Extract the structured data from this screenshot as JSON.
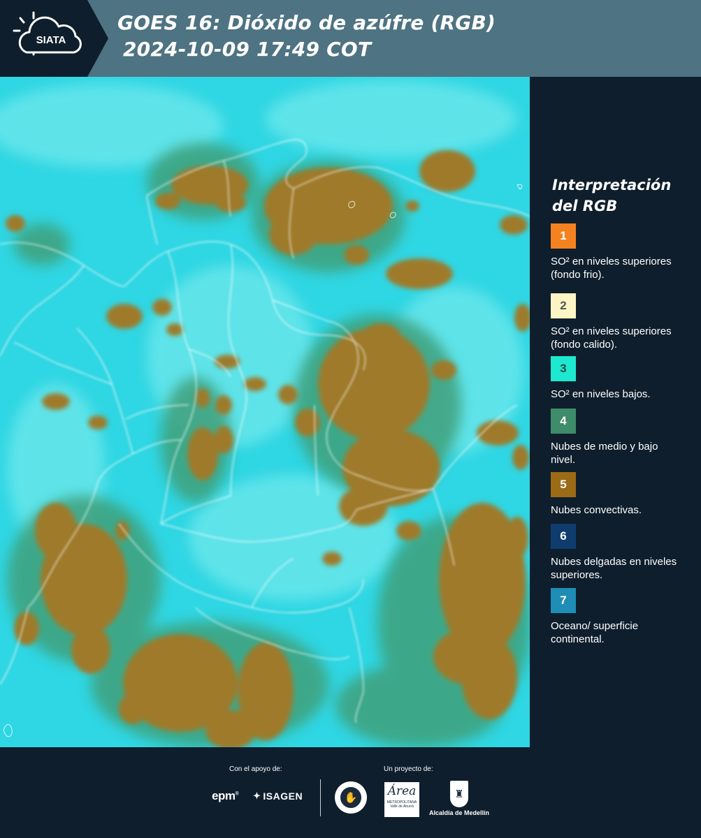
{
  "header": {
    "logo_text": "SIATA",
    "title_line1": "GOES 16: Dióxido de azúfre (RGB)",
    "title_line2": "2024-10-09 17:49 COT",
    "background_color": "#4e7382",
    "logo_panel_color": "#0f1e2c"
  },
  "map": {
    "colors": {
      "background": "#2fd6e3",
      "clear": "#6ee8ec",
      "low_clouds": "#3fa07a",
      "convective": "#9e7a2c",
      "boundaries": "#ffffff"
    }
  },
  "legend": {
    "title": "Interpretación del RGB",
    "items": [
      {
        "number": "1",
        "color": "#f58220",
        "text_color": "#ffffff",
        "label": "SO² en niveles superiores (fondo frio)."
      },
      {
        "number": "2",
        "color": "#fdf5c4",
        "text_color": "#555555",
        "label": "SO² en niveles superiores (fondo calido)."
      },
      {
        "number": "3",
        "color": "#1de8d0",
        "text_color": "#2a4a4a",
        "label": "SO² en niveles bajos."
      },
      {
        "number": "4",
        "color": "#3e8c6a",
        "text_color": "#ffffff",
        "label": "Nubes de medio y bajo nivel."
      },
      {
        "number": "5",
        "color": "#9c6b16",
        "text_color": "#ffffff",
        "label": "Nubes convectivas."
      },
      {
        "number": "6",
        "color": "#0f3c6e",
        "text_color": "#ffffff",
        "label": "Nubes delgadas en niveles superiores."
      },
      {
        "number": "7",
        "color": "#1f8db5",
        "text_color": "#ffffff",
        "label": "Oceano/ superficie continental."
      }
    ]
  },
  "footer": {
    "support_label": "Con el apoyo de:",
    "project_label": "Un proyecto de:",
    "sponsors": [
      "epm",
      "ISAGEN"
    ],
    "partners": {
      "area_script": "Área",
      "area_name": "METROPOLITANA",
      "area_sub": "Valle de Aburrá",
      "alcaldia": "Alcaldía de Medellín"
    }
  }
}
